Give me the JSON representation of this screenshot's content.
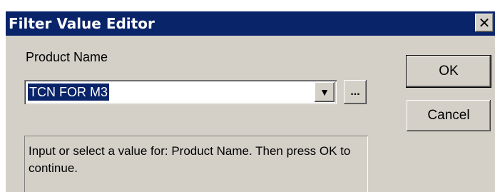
{
  "window": {
    "title": "Filter Value Editor",
    "close_glyph": "✕"
  },
  "field": {
    "label": "Product Name",
    "value": "TCN FOR M3",
    "dropdown_icon": "chevron-down-icon",
    "browse_label": "..."
  },
  "buttons": {
    "ok": "OK",
    "cancel": "Cancel"
  },
  "info": {
    "text": "Input or select a value for: Product Name.  Then press OK to continue."
  },
  "colors": {
    "titlebar": "#0a246a",
    "dialog_face": "#d4d0c8",
    "selection": "#0a246a"
  }
}
